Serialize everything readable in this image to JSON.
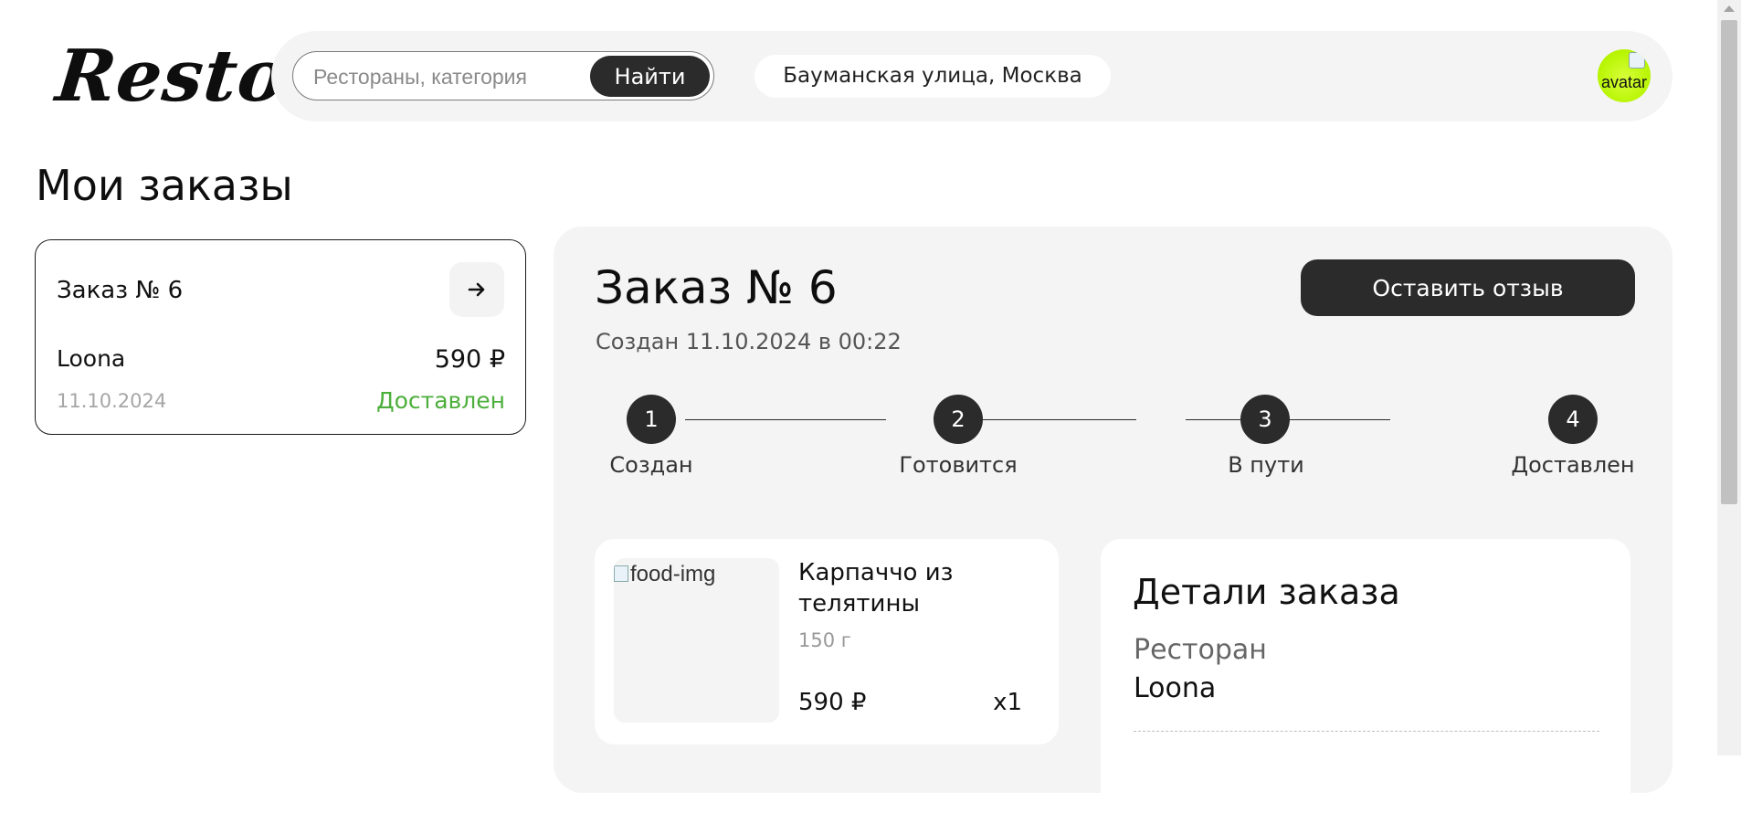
{
  "header": {
    "logo": "Resto",
    "search": {
      "placeholder": "Рестораны, категория",
      "value": "",
      "button_label": "Найти"
    },
    "address": "Бауманская улица, Москва",
    "avatar_alt": "avatar"
  },
  "page_title": "Мои заказы",
  "orders_list": [
    {
      "title": "Заказ № 6",
      "restaurant": "Loona",
      "price": "590 ₽",
      "date": "11.10.2024",
      "status": "Доставлен",
      "status_color": "#4caf3b"
    }
  ],
  "order_detail": {
    "title": "Заказ № 6",
    "created": "Создан 11.10.2024 в 00:22",
    "review_button": "Оставить отзыв",
    "steps": [
      {
        "number": "1",
        "label": "Создан"
      },
      {
        "number": "2",
        "label": "Готовится"
      },
      {
        "number": "3",
        "label": "В пути"
      },
      {
        "number": "4",
        "label": "Доставлен"
      }
    ],
    "items": [
      {
        "image_alt": "food-img",
        "name": "Карпаччо из телятины",
        "weight": "150 г",
        "price": "590 ₽",
        "quantity": "x1"
      }
    ],
    "details": {
      "title": "Детали заказа",
      "restaurant_label": "Ресторан",
      "restaurant_value": "Loona"
    }
  },
  "colors": {
    "accent_dark": "#2b2b2b",
    "panel_bg": "#f4f4f4",
    "status_green": "#4caf3b"
  },
  "icons": {
    "arrow": "arrow-right-icon",
    "avatar": "avatar-icon"
  }
}
